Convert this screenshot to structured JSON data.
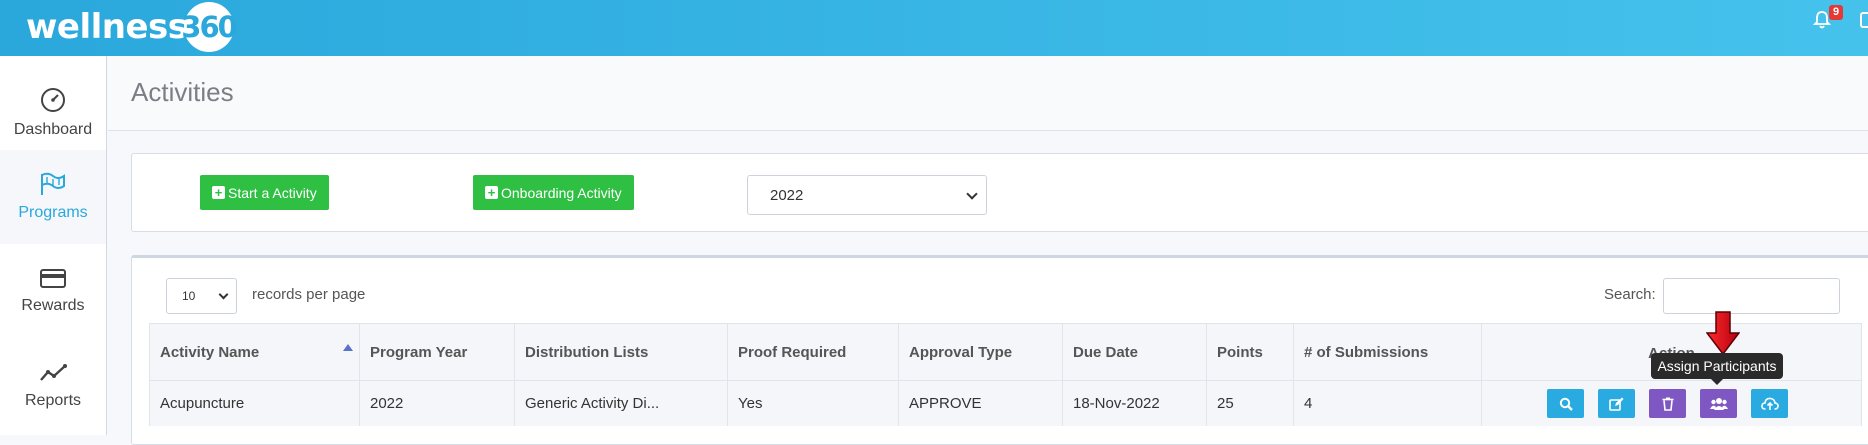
{
  "brand": {
    "name": "wellness",
    "number": "360"
  },
  "notifications": {
    "count": "9"
  },
  "sidebar": {
    "items": [
      {
        "label": "Dashboard",
        "icon": "speedometer-icon"
      },
      {
        "label": "Programs",
        "icon": "flag-icon",
        "active": true
      },
      {
        "label": "Rewards",
        "icon": "credit-card-icon"
      },
      {
        "label": "Reports",
        "icon": "line-chart-icon"
      }
    ]
  },
  "page": {
    "title": "Activities"
  },
  "toolbar": {
    "start_label": "Start a Activity",
    "onboarding_label": "Onboarding Activity",
    "year_value": "2022"
  },
  "table_controls": {
    "length_value": "10",
    "length_label": "records per page",
    "search_label": "Search:"
  },
  "table": {
    "columns": [
      "Activity Name",
      "Program Year",
      "Distribution Lists",
      "Proof Required",
      "Approval Type",
      "Due Date",
      "Points",
      "# of Submissions",
      "Action"
    ],
    "rows": [
      [
        "Acupuncture",
        "2022",
        "Generic Activity Di...",
        "Yes",
        "APPROVE",
        "18-Nov-2022",
        "25",
        "4"
      ]
    ],
    "action_buttons": [
      {
        "icon": "search-icon",
        "color": "#29abe2"
      },
      {
        "icon": "edit-icon",
        "color": "#29abe2"
      },
      {
        "icon": "trash-icon",
        "color": "#7e57c2"
      },
      {
        "icon": "users-icon",
        "color": "#7e57c2"
      },
      {
        "icon": "cloud-upload-icon",
        "color": "#29abe2"
      }
    ]
  },
  "tooltip": {
    "text": "Assign Participants"
  },
  "colors": {
    "header": "#2aa8dc",
    "primary_green": "#2fc043",
    "info": "#29abe2",
    "purple": "#7e57c2",
    "arrow_red": "#e0001a"
  }
}
